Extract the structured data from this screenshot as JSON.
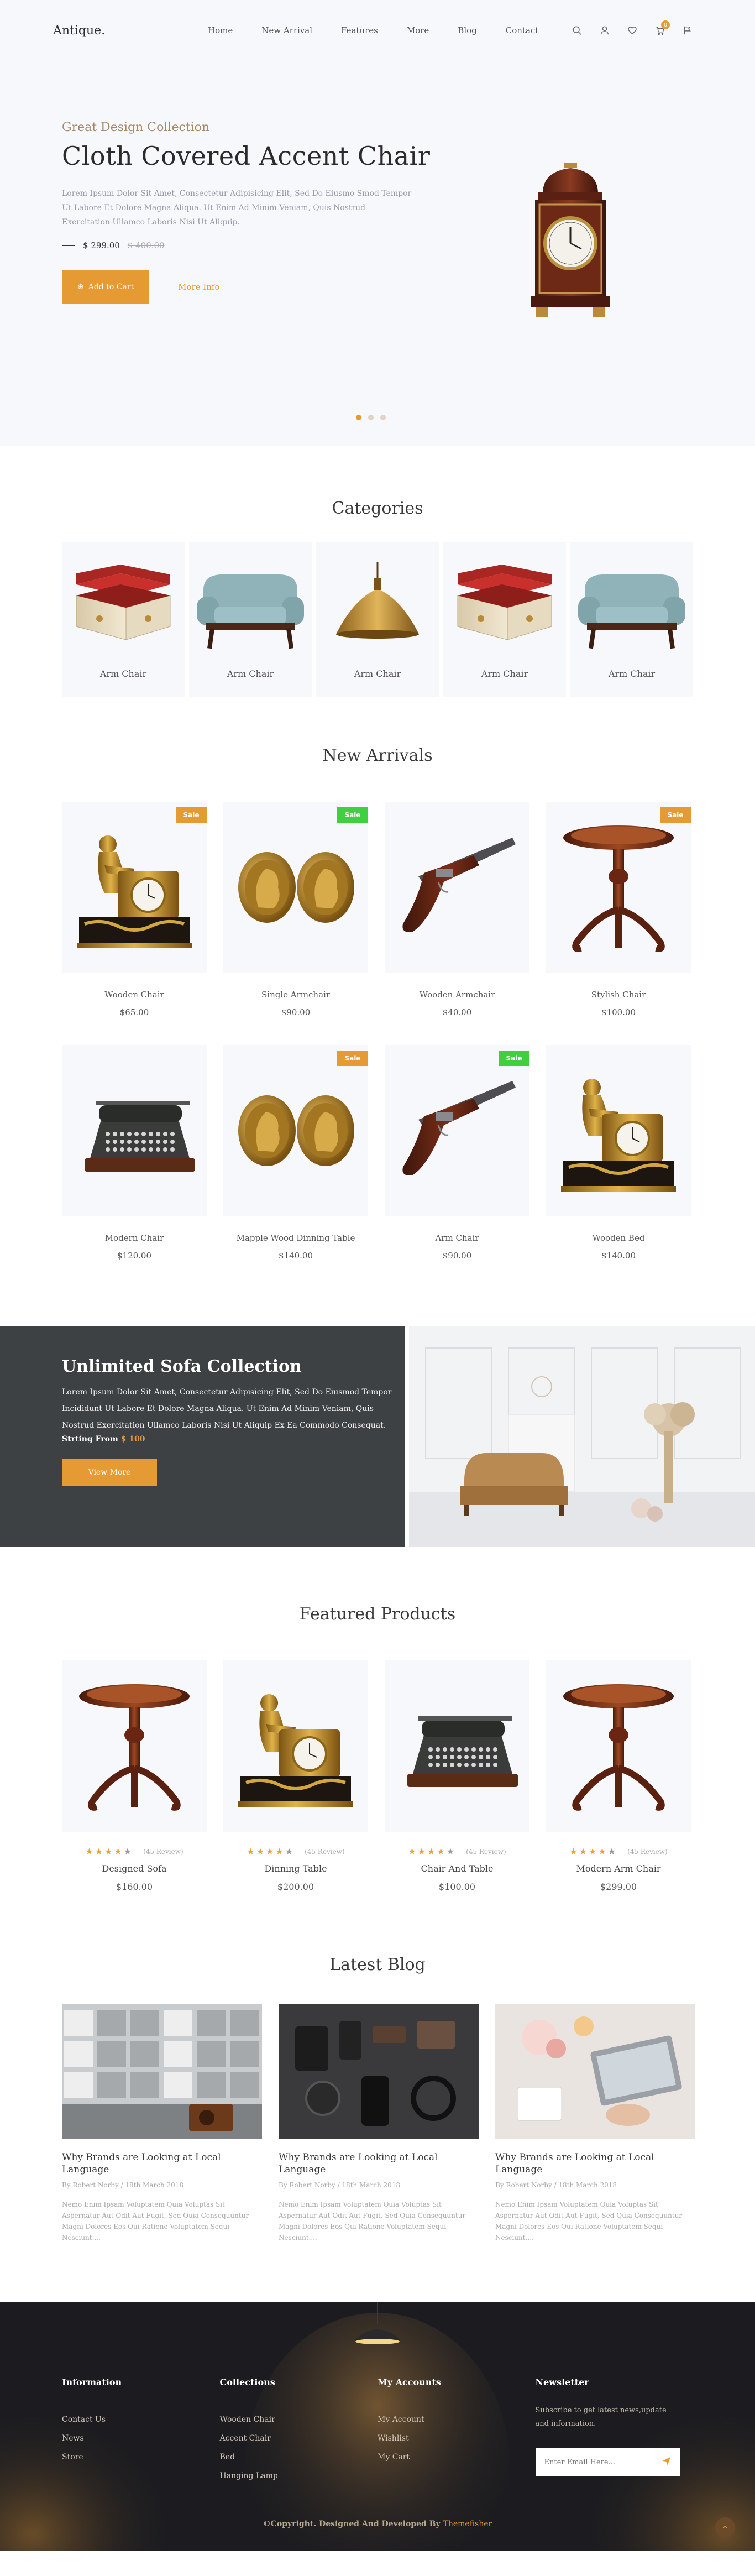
{
  "header": {
    "logo": "Antique.",
    "nav": [
      "Home",
      "New Arrival",
      "Features",
      "More",
      "Blog",
      "Contact"
    ],
    "cart_count": "0",
    "icons": [
      "search-icon",
      "user-icon",
      "heart-icon",
      "cart-icon",
      "flag-icon"
    ]
  },
  "hero": {
    "subtitle": "Great Design Collection",
    "title": "Cloth Covered Accent Chair",
    "description": "Lorem Ipsum Dolor Sit Amet, Consectetur Adipisicing Elit, Sed Do Eiusmo Smod Tempor Ut Labore Et Dolore Magna Aliqua. Ut Enim Ad Minim Veniam, Quis Nostrud Exercitation Ullamco Laboris Nisi Ut Aliquip.",
    "price": "$ 299.00",
    "old_price": "$ 400.00",
    "add_to_cart": "Add to Cart",
    "more_info": "More Info",
    "slides": 3,
    "active_slide": 1
  },
  "categories": {
    "title": "Categories",
    "items": [
      {
        "label": "Arm Chair",
        "image": "jewelry-box"
      },
      {
        "label": "Arm Chair",
        "image": "sofa"
      },
      {
        "label": "Arm Chair",
        "image": "brass-lamp"
      },
      {
        "label": "Arm Chair",
        "image": "jewelry-box"
      },
      {
        "label": "Arm Chair",
        "image": "sofa"
      }
    ]
  },
  "new_arrivals": {
    "title": "New Arrivals",
    "products": [
      {
        "name": "Wooden Chair",
        "price": "$65.00",
        "sale": "Sale",
        "sale_color": "orange",
        "image": "gold-clock"
      },
      {
        "name": "Single Armchair",
        "price": "$90.00",
        "sale": "Sale",
        "sale_color": "green",
        "image": "cameo"
      },
      {
        "name": "Wooden Armchair",
        "price": "$40.00",
        "sale": "",
        "sale_color": "",
        "image": "pistol"
      },
      {
        "name": "Stylish Chair",
        "price": "$100.00",
        "sale": "Sale",
        "sale_color": "orange",
        "image": "table"
      },
      {
        "name": "Modern Chair",
        "price": "$120.00",
        "sale": "",
        "sale_color": "",
        "image": "typewriter"
      },
      {
        "name": "Mapple Wood Dinning Table",
        "price": "$140.00",
        "sale": "Sale",
        "sale_color": "orange",
        "image": "cameo"
      },
      {
        "name": "Arm Chair",
        "price": "$90.00",
        "sale": "Sale",
        "sale_color": "green",
        "image": "pistol"
      },
      {
        "name": "Wooden Bed",
        "price": "$140.00",
        "sale": "",
        "sale_color": "",
        "image": "gold-clock"
      }
    ]
  },
  "promo": {
    "title": "Unlimited Sofa Collection",
    "description": "Lorem Ipsum Dolor Sit Amet, Consectetur Adipisicing Elit, Sed Do Eiusmod Tempor Incididunt Ut Labore Et Dolore Magna Aliqua. Ut Enim Ad Minim Veniam, Quis Nostrud Exercitation Ullamco Laboris Nisi Ut Aliquip Ex Ea Commodo Consequat.",
    "price_label": "Strting From",
    "price": "$ 100",
    "button": "View More"
  },
  "featured": {
    "title": "Featured Products",
    "products": [
      {
        "name": "Designed Sofa",
        "price": "$160.00",
        "reviews": "(45 Review)",
        "rating": 4,
        "image": "table"
      },
      {
        "name": "Dinning Table",
        "price": "$200.00",
        "reviews": "(45 Review)",
        "rating": 4,
        "image": "gold-clock"
      },
      {
        "name": "Chair And Table",
        "price": "$100.00",
        "reviews": "(45 Review)",
        "rating": 4,
        "image": "typewriter"
      },
      {
        "name": "Modern Arm Chair",
        "price": "$299.00",
        "reviews": "(45 Review)",
        "rating": 4,
        "image": "table"
      }
    ]
  },
  "blog": {
    "title": "Latest Blog",
    "posts": [
      {
        "title": "Why Brands are Looking at Local Language",
        "meta": "By Robert Norby / 18th March 2018",
        "excerpt": "Nemo Enim Ipsam Voluptatem Quia Voluptas Sit Aspernatur Aut Odit Aut Fugit, Sed Quia Consequuntur Magni Dolores Eos Qui Ratione Voluptatem Sequi Nesciunt....",
        "image": "shelves"
      },
      {
        "title": "Why Brands are Looking at Local Language",
        "meta": "By Robert Norby / 18th March 2018",
        "excerpt": "Nemo Enim Ipsam Voluptatem Quia Voluptas Sit Aspernatur Aut Odit Aut Fugit, Sed Quia Consequuntur Magni Dolores Eos Qui Ratione Voluptatem Sequi Nesciunt....",
        "image": "flatlay"
      },
      {
        "title": "Why Brands are Looking at Local Language",
        "meta": "By Robert Norby / 18th March 2018",
        "excerpt": "Nemo Enim Ipsam Voluptatem Quia Voluptas Sit Aspernatur Aut Odit Aut Fugit, Sed Quia Consequuntur Magni Dolores Eos Qui Ratione Voluptatem Sequi Nesciunt....",
        "image": "desk"
      }
    ]
  },
  "footer": {
    "columns": [
      {
        "title": "Information",
        "links": [
          "Contact Us",
          "News",
          "Store"
        ]
      },
      {
        "title": "Collections",
        "links": [
          "Wooden Chair",
          "Accent Chair",
          "Bed",
          "Hanging Lamp"
        ]
      },
      {
        "title": "My Accounts",
        "links": [
          "My Account",
          "Wishlist",
          "My Cart"
        ]
      }
    ],
    "newsletter": {
      "title": "Newsletter",
      "description": "Subscribe to get latest news,update and information.",
      "placeholder": "Enter Email Here..."
    },
    "copyright": "©Copyright. Designed And Developed By",
    "brand": "Themefisher"
  }
}
